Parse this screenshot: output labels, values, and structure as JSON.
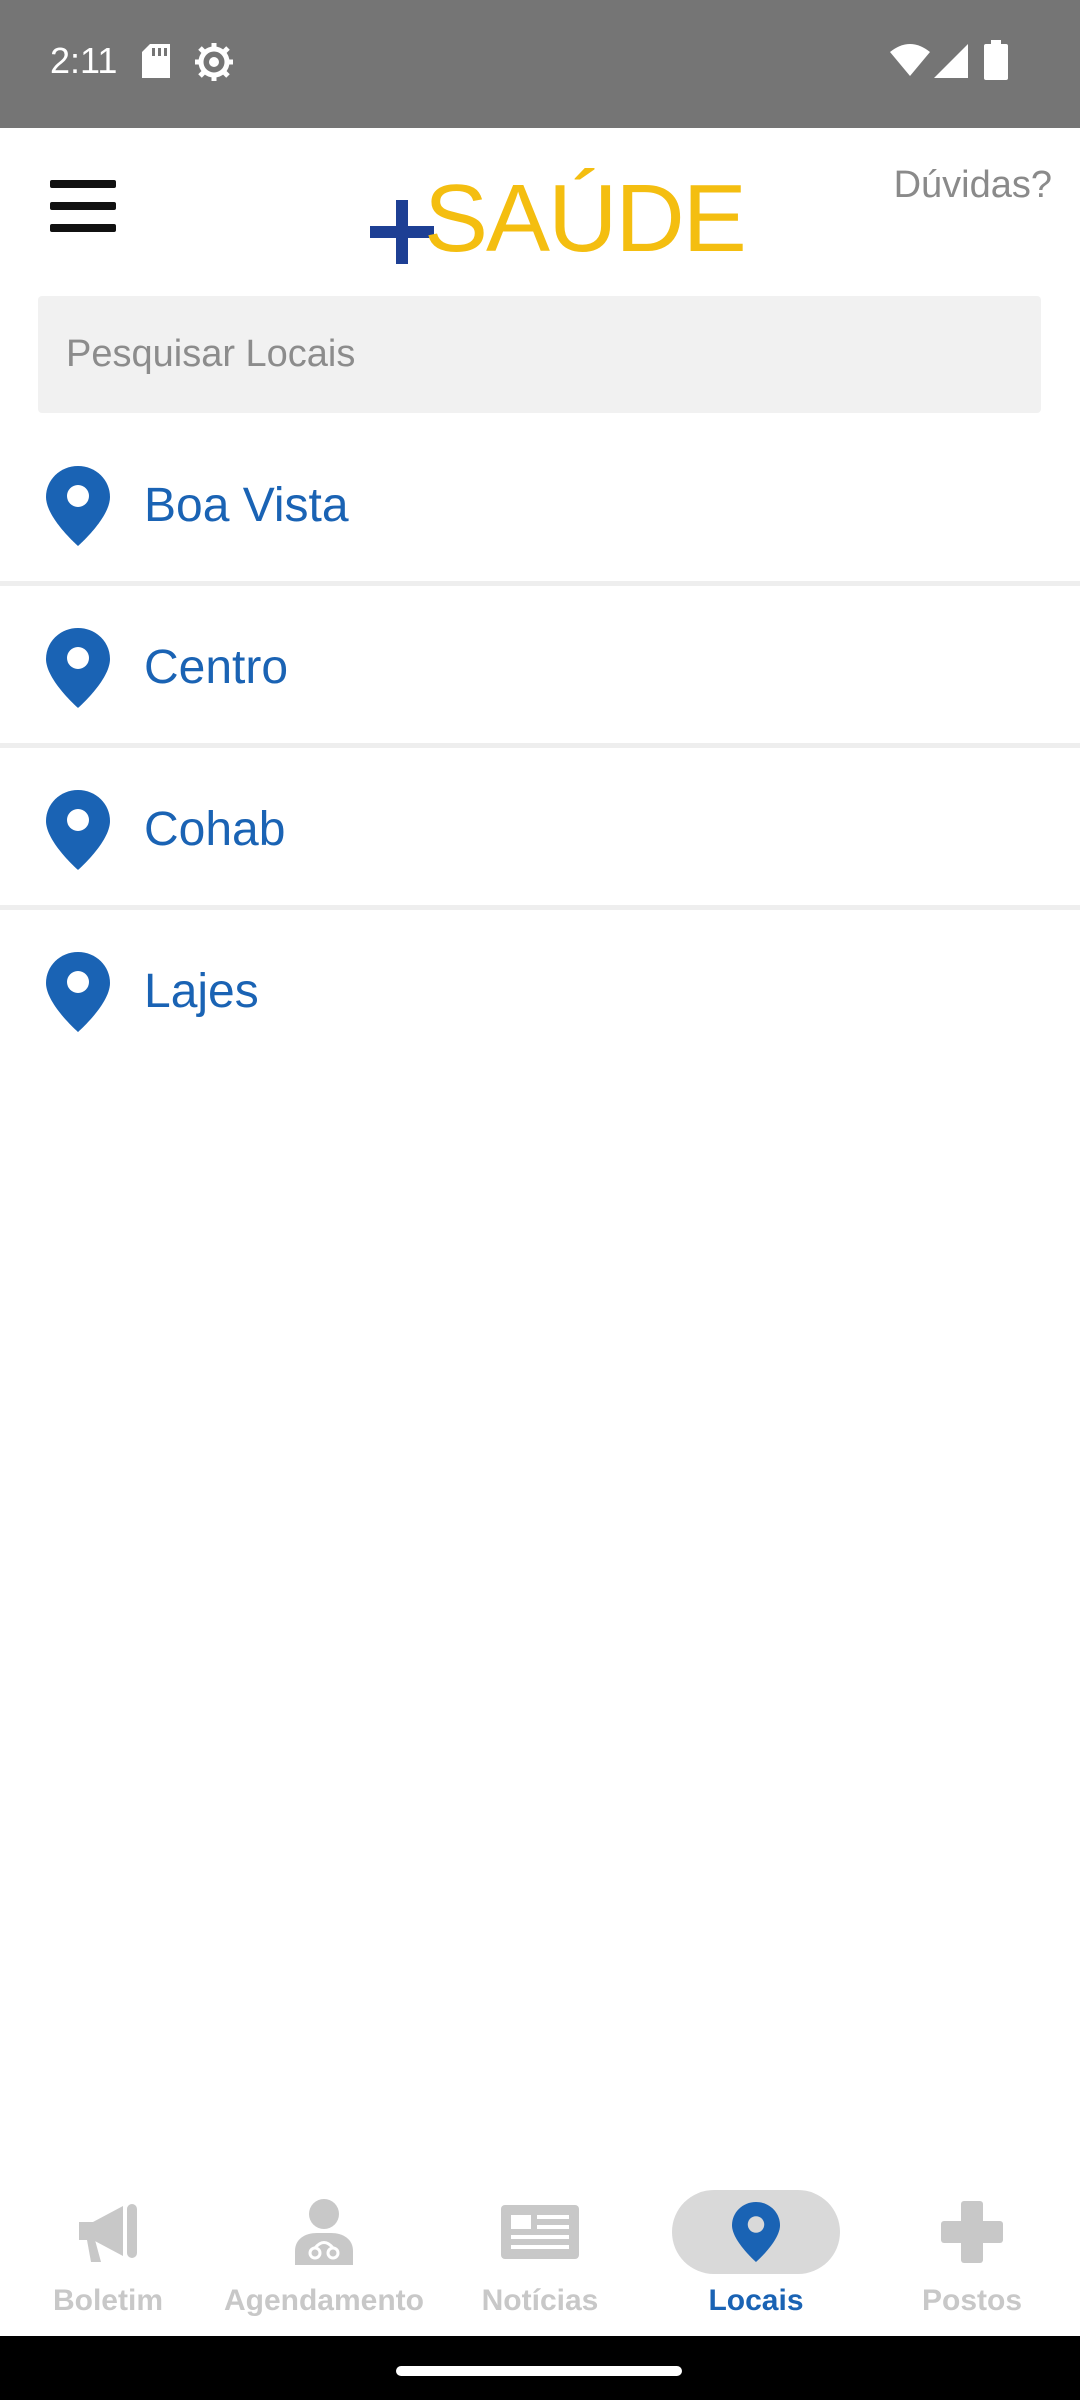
{
  "status_bar": {
    "time": "2:11"
  },
  "header": {
    "logo_plus": "+",
    "logo_text": "SAÚDE",
    "help_label": "Dúvidas?"
  },
  "search": {
    "placeholder": "Pesquisar Locais",
    "value": ""
  },
  "locations": [
    {
      "label": "Boa Vista"
    },
    {
      "label": "Centro"
    },
    {
      "label": "Cohab"
    },
    {
      "label": "Lajes"
    }
  ],
  "bottom_nav": [
    {
      "label": "Boletim",
      "icon": "megaphone-icon",
      "active": false
    },
    {
      "label": "Agendamento",
      "icon": "doctor-icon",
      "active": false
    },
    {
      "label": "Notícias",
      "icon": "newspaper-icon",
      "active": false
    },
    {
      "label": "Locais",
      "icon": "map-pin-icon",
      "active": true
    },
    {
      "label": "Postos",
      "icon": "medical-cross-icon",
      "active": false
    }
  ],
  "colors": {
    "primary_blue": "#1a63b4",
    "logo_yellow": "#F4BE10",
    "logo_plus_blue": "#1d3f94",
    "inactive_gray": "#c8c8c8",
    "status_bar": "#757575"
  }
}
